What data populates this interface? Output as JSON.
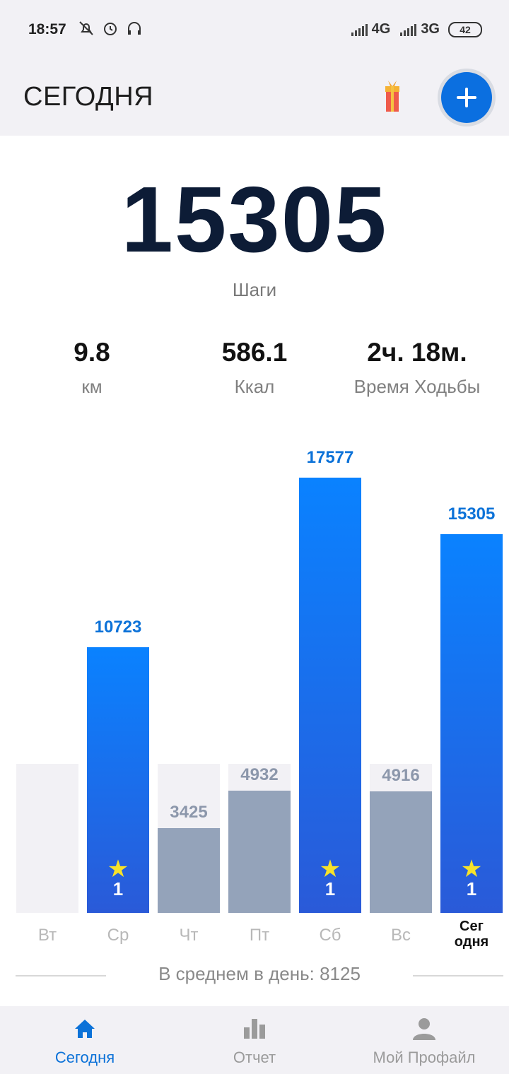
{
  "status_bar": {
    "time": "18:57",
    "network1": "4G",
    "network2": "3G",
    "battery": "42"
  },
  "header": {
    "title": "СЕГОДНЯ"
  },
  "summary": {
    "steps": "15305",
    "steps_label": "Шаги",
    "distance_value": "9.8",
    "distance_unit": "км",
    "calories_value": "586.1",
    "calories_unit": "Ккал",
    "time_value": "2ч. 18м.",
    "time_label": "Время Ходьбы"
  },
  "chart_data": {
    "type": "bar",
    "categories": [
      "Вт",
      "Ср",
      "Чт",
      "Пт",
      "Сб",
      "Вс",
      "Сег одня"
    ],
    "values": [
      0,
      10723,
      3425,
      4932,
      17577,
      4916,
      15305
    ],
    "goal_reached": [
      false,
      true,
      false,
      false,
      true,
      false,
      true
    ],
    "value_labels": [
      "",
      "10723",
      "3425",
      "4932",
      "17577",
      "4916",
      "15305"
    ],
    "star_counts": [
      "",
      "1",
      "",
      "",
      "1",
      "",
      "1"
    ],
    "colors": {
      "goal_met": "#0a82ff",
      "goal_missed": "#94a3ba",
      "track": "#f2f1f5"
    }
  },
  "average_label": "В среднем в день: 8125",
  "nav": {
    "items": [
      {
        "label": "Сегодня",
        "icon": "home-icon",
        "active": true
      },
      {
        "label": "Отчет",
        "icon": "bar-chart-icon",
        "active": false
      },
      {
        "label": "Мой Профайл",
        "icon": "person-icon",
        "active": false
      }
    ]
  },
  "accent_color": "#0c72d8"
}
